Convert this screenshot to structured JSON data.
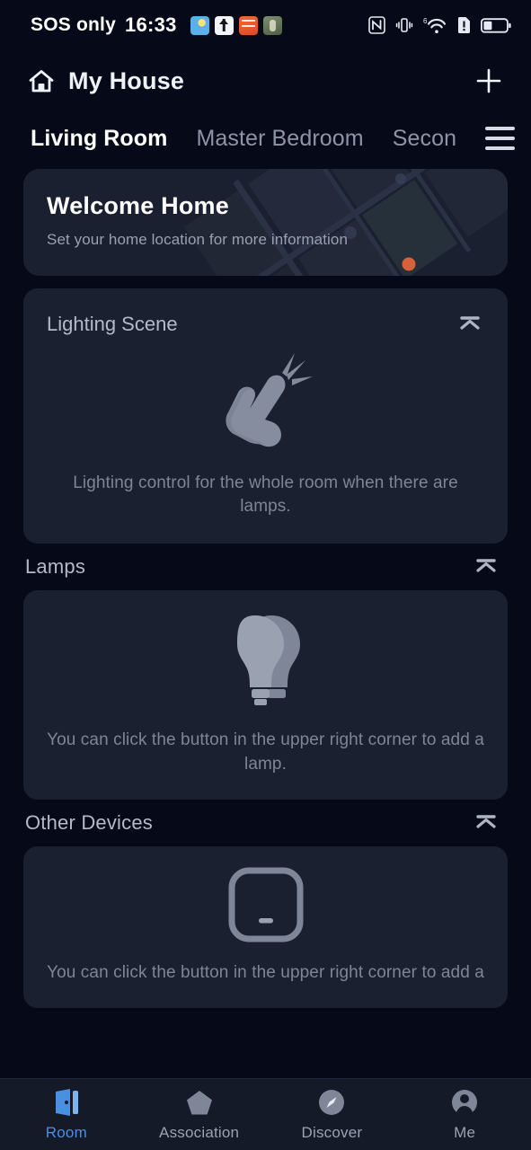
{
  "status_bar": {
    "carrier": "SOS only",
    "time": "16:33",
    "notification_icons": [
      "globe-app-icon",
      "upload-arrow-app-icon",
      "orange-novel-app-icon",
      "green-game-app-icon"
    ],
    "right_icons": [
      "nfc-icon",
      "vibrate-icon",
      "wifi-6-icon",
      "sim-alert-icon",
      "battery-icon"
    ],
    "wifi_generation": "6"
  },
  "header": {
    "title": "My House",
    "home_icon": "house-icon",
    "add_button": "add-icon"
  },
  "room_tabs": {
    "items": [
      {
        "label": "Living Room",
        "active": true
      },
      {
        "label": "Master Bedroom",
        "active": false
      },
      {
        "label": "Secon",
        "active": false
      }
    ],
    "menu_icon": "hamburger-menu-icon"
  },
  "welcome_card": {
    "title": "Welcome Home",
    "subtitle": "Set your home location for more information",
    "marker_color": "#d8603a"
  },
  "lighting_scene": {
    "title": "Lighting Scene",
    "collapse_icon": "collapse-up-icon",
    "empty_icon": "tap-hand-icon",
    "empty_text": "Lighting control for the whole room when there are lamps."
  },
  "lamps": {
    "title": "Lamps",
    "collapse_icon": "collapse-up-icon",
    "empty_icon": "light-bulbs-icon",
    "empty_text": "You can click the button in the upper right corner to add a lamp."
  },
  "other_devices": {
    "title": "Other Devices",
    "collapse_icon": "collapse-up-icon",
    "empty_icon": "device-square-icon",
    "empty_text": "You can click the button in the upper right corner to add a"
  },
  "bottom_nav": {
    "items": [
      {
        "label": "Room",
        "icon": "door-icon",
        "active": true
      },
      {
        "label": "Association",
        "icon": "pentagon-icon",
        "active": false
      },
      {
        "label": "Discover",
        "icon": "compass-icon",
        "active": false
      },
      {
        "label": "Me",
        "icon": "person-icon",
        "active": false
      }
    ],
    "active_color": "#4a8fe0"
  }
}
